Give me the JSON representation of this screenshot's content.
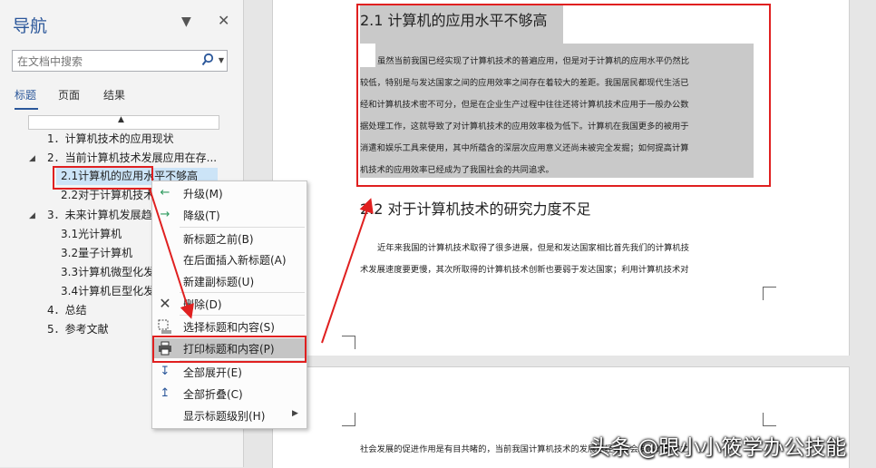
{
  "nav": {
    "title": "导航",
    "search_placeholder": "在文档中搜索",
    "tabs": [
      {
        "label": "标题"
      },
      {
        "label": "页面"
      },
      {
        "label": "结果"
      }
    ],
    "tree": [
      {
        "label": "1．计算机技术的应用现状"
      },
      {
        "label": "2．当前计算机技术发展应用在存..."
      },
      {
        "label": "2.1计算机的应用水平不够高"
      },
      {
        "label": "2.2对于计算机技术"
      },
      {
        "label": "3．未来计算机发展趋"
      },
      {
        "label": "3.1光计算机"
      },
      {
        "label": "3.2量子计算机"
      },
      {
        "label": "3.3计算机微型化发"
      },
      {
        "label": "3.4计算机巨型化发"
      },
      {
        "label": "4．总结"
      },
      {
        "label": "5．参考文献"
      }
    ]
  },
  "menu": {
    "items": [
      {
        "label": "升级(M)"
      },
      {
        "label": "降级(T)"
      },
      {
        "label": "新标题之前(B)"
      },
      {
        "label": "在后面插入新标题(A)"
      },
      {
        "label": "新建副标题(U)"
      },
      {
        "label": "删除(D)"
      },
      {
        "label": "选择标题和内容(S)"
      },
      {
        "label": "打印标题和内容(P)"
      },
      {
        "label": "全部展开(E)"
      },
      {
        "label": "全部折叠(C)"
      },
      {
        "label": "显示标题级别(H)"
      }
    ]
  },
  "doc": {
    "heading1": "2.1 计算机的应用水平不够高",
    "para1": [
      "虽然当前我国已经实现了计算机技术的普遍应用，但是对于计算机的应用水平仍然比",
      "较低，特别是与发达国家之间的应用效率之间存在着较大的差距。我国居民都现代生活已",
      "经和计算机技术密不可分，但是在企业生产过程中往往还将计算机技术应用于一般办公数",
      "据处理工作，这就导致了对计算机技术的应用效率极为低下。计算机在我国更多的被用于",
      "消遣和娱乐工具来使用，其中所蕴含的深层次应用意义还尚未被完全发掘；如何提高计算",
      "机技术的应用效率已经成为了我国社会的共同追求。"
    ],
    "heading2": "2.2 对于计算机技术的研究力度不足",
    "para2": [
      "近年来我国的计算机技术取得了很多进展，但是和发达国家相比首先我们的计算机技",
      "术发展速度要更慢，其次所取得的计算机技术创新也要弱于发达国家；利用计算机技术对"
    ],
    "page2_line": "社会发展的促进作用是有目共睹的，当前我国计算机技术的发展已经与社会发展的需求之"
  },
  "watermark": "头条 @跟小小筱学办公技能",
  "colors": {
    "accent": "#2b579a",
    "annotation": "#e02020",
    "selection": "#cce4f7",
    "highlight": "#c9c9c9"
  }
}
